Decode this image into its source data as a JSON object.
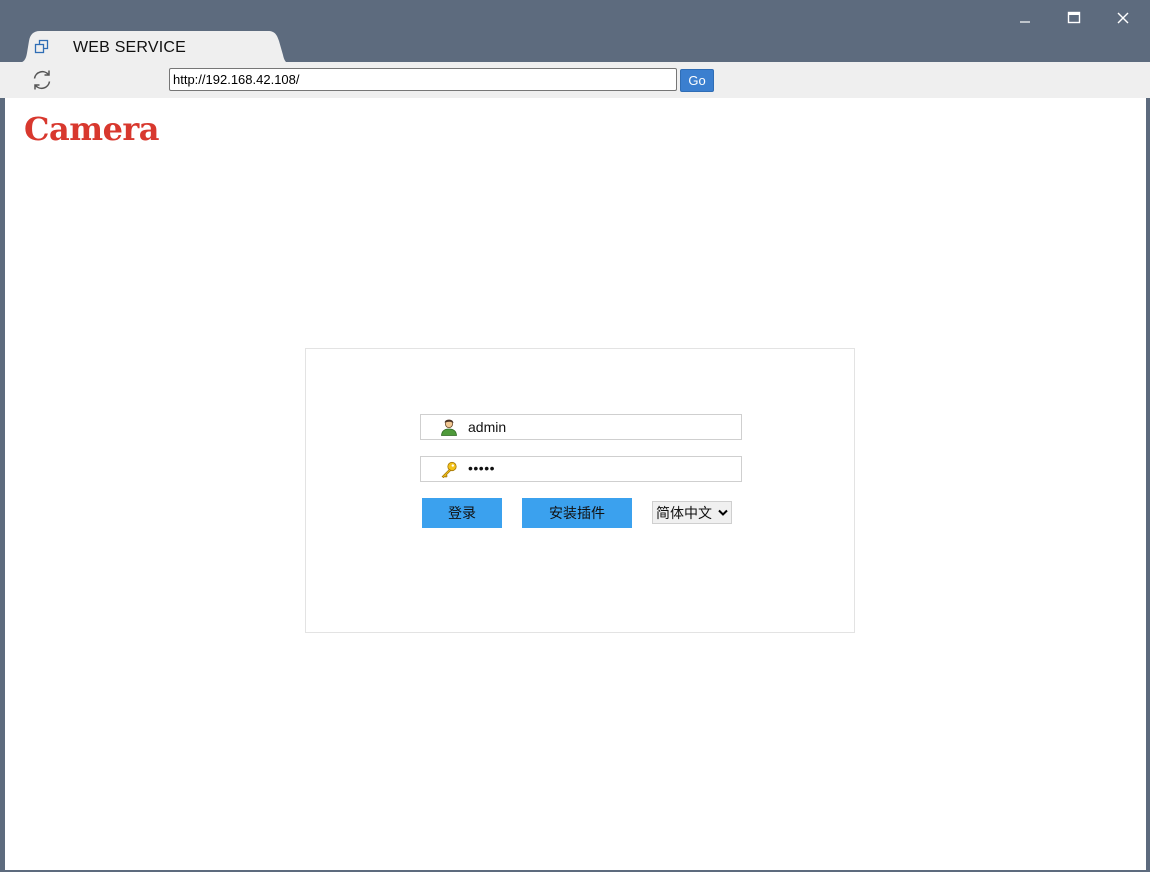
{
  "window": {
    "tab_title": "WEB SERVICE",
    "icons": {
      "minimize": "minimize-icon",
      "maximize": "maximize-icon",
      "close": "close-icon",
      "tab": "window-restore-icon",
      "reload": "reload-icon"
    }
  },
  "toolbar": {
    "url": "http://192.168.42.108/",
    "go_label": "Go"
  },
  "page": {
    "logo_text": "Camera",
    "logo_color": "#d8382e",
    "login": {
      "username": "admin",
      "password_mask": "•••••",
      "login_label": "登录",
      "install_plugin_label": "安装插件",
      "language_selected": "简体中文",
      "button_color": "#3ba1ee"
    }
  }
}
